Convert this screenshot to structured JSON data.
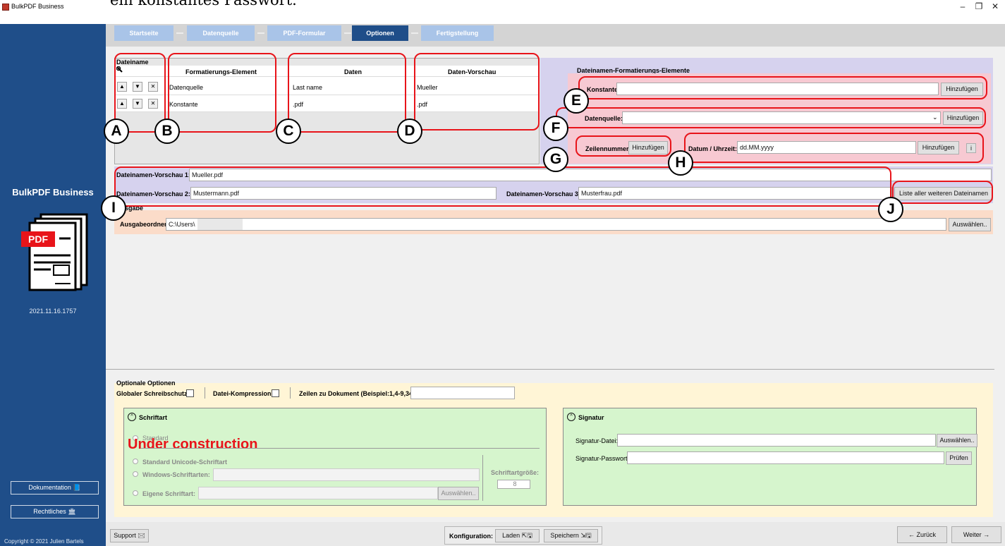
{
  "window": {
    "title": "BulkPDF Business",
    "overlay_caption": "ein konstantes Passwort.",
    "min": "–",
    "max": "❐",
    "close": "✕"
  },
  "sidebar": {
    "app_name": "BulkPDF Business",
    "logo_text": "PDF",
    "version": "2021.11.16.1757",
    "doc_button": "Dokumentation 📘",
    "legal_button": "Rechtliches 🏛",
    "copyright": "Copyright © 2021 Julien Bartels"
  },
  "breadcrumb": {
    "steps": [
      "Startseite",
      "Datenquelle",
      "PDF-Formular",
      "Optionen",
      "Fertigstellung"
    ],
    "active_index": 3
  },
  "filename": {
    "section_label": "Dateiname",
    "wrench_icon": "wrench-icon",
    "columns": [
      "Formatierungs-Element",
      "Daten",
      "Daten-Vorschau"
    ],
    "rows": [
      {
        "element": "Datenquelle",
        "data": "Last name",
        "preview": "Mueller"
      },
      {
        "element": "Konstante",
        "data": ".pdf",
        "preview": ".pdf"
      }
    ]
  },
  "elements": {
    "title": "Dateinamen-Formatierungs-Elemente",
    "konstante_label": "Konstante:",
    "datenquelle_label": "Datenquelle:",
    "zeilennummer_label": "Zeilennummer:",
    "datetime_label": "Datum / Uhrzeit:",
    "datetime_value": "dd.MM.yyyy",
    "add": "Hinzufügen",
    "info": "i"
  },
  "preview": {
    "label1": "Dateinamen-Vorschau 1:",
    "value1": "Mueller.pdf",
    "label2": "Dateinamen-Vorschau 2:",
    "value2": "Mustermann.pdf",
    "label3": "Dateinamen-Vorschau 3:",
    "value3": "Musterfrau.pdf",
    "list_button": "Liste aller weiteren Dateinamen"
  },
  "output": {
    "title": "Ausgabe",
    "folder_label": "Ausgabeordner:",
    "folder_value": "C:\\Users\\",
    "choose": "Auswählen.."
  },
  "options": {
    "title": "Optionale Optionen",
    "write_protect": "Globaler Schreibschutz:",
    "compression": "Datei-Kompression:",
    "rows_label": "Zeilen zu Dokument (Beispiel:1,4-9,34):",
    "font": {
      "title": "Schriftart",
      "standard": "Standard",
      "construction": "Under construction",
      "unicode": "Standard Unicode-Schriftart",
      "windows": "Windows-Schriftarten:",
      "own": "Eigene Schriftart:",
      "choose": "Auswählen..",
      "size_label": "Schriftartgröße:",
      "size_value": "8"
    },
    "signature": {
      "title": "Signatur",
      "file_label": "Signatur-Datei:",
      "choose": "Auswählen..",
      "password_label": "Signatur-Passwort:",
      "check": "Prüfen"
    }
  },
  "bottom": {
    "support": "Support 🖂",
    "config_label": "Konfiguration:",
    "load": "Laden ⇱🖫",
    "save": "Speichern ⇲🖫",
    "back": "← Zurück",
    "next": "Weiter →"
  },
  "annotations": {
    "a": "A",
    "b": "B",
    "c": "C",
    "d": "D",
    "e": "E",
    "f": "F",
    "g": "G",
    "h": "H",
    "i": "I",
    "j": "J"
  },
  "colors": {
    "sidebar": "#1f4e89",
    "annotation_red": "#e8141a",
    "panel_lilac": "#d6d2ee",
    "panel_pink": "#f7c9d2",
    "output_peach": "#fbdcc9",
    "options_cream": "#fff5d6",
    "green": "#d6f5cd"
  }
}
